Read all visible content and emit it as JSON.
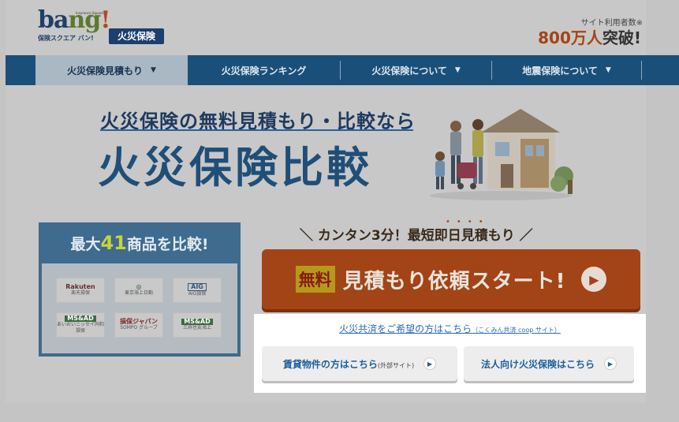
{
  "header": {
    "logo_text": "bang!",
    "logo_tagline": "保険スクエア バン!",
    "logo_mini": "Insurance Square",
    "product_badge": "火災保険",
    "users_label": "サイト利用者数※",
    "users_count": "800万人",
    "users_suffix": "突破!"
  },
  "nav": {
    "items": [
      {
        "label": "火災保険見積もり",
        "has_caret": true,
        "active": true
      },
      {
        "label": "火災保険ランキング",
        "has_caret": false,
        "active": false
      },
      {
        "label": "火災保険について",
        "has_caret": true,
        "active": false
      },
      {
        "label": "地震保険について",
        "has_caret": true,
        "active": false
      }
    ],
    "caret": "▼"
  },
  "hero": {
    "subtitle": "火災保険の無料見積もり・比較なら",
    "title": "火災保険比較"
  },
  "compare": {
    "title_prefix": "最大",
    "title_number": "41",
    "title_suffix": "商品を比較!",
    "insurers": [
      {
        "main": "Rakuten",
        "sub": "楽天損保",
        "kind": "rakuten"
      },
      {
        "main": "◎",
        "sub": "東京海上日動",
        "kind": "tokio"
      },
      {
        "main": "AIG",
        "sub": "AIG損保",
        "kind": "aig"
      },
      {
        "main": "MS&AD",
        "sub": "あいおいニッセイ同和損保",
        "kind": "ms"
      },
      {
        "main": "損保ジャパン",
        "sub": "SOMPO グループ",
        "kind": "sompo"
      },
      {
        "main": "MS&AD",
        "sub": "三井住友海上",
        "kind": "ms"
      }
    ]
  },
  "cta": {
    "lead": "＼ カンタン3分！最短即日見積もり ／",
    "free_badge": "無料",
    "button_text": "見積もり依頼スタート!",
    "arrow": "▶"
  },
  "links": {
    "kyosai": "火災共済をご希望の方はこちら",
    "kyosai_note": "（こくみん共済 coop サイト）",
    "rental_label": "賃貸物件の方はこちら",
    "rental_note": "(外部サイト)",
    "corporate_label": "法人向け火災保険はこちら",
    "arrow": "▶"
  },
  "colors": {
    "nav_bg": "#1a4f7a",
    "cta_bg": "#a34416",
    "brand_navy": "#1f4f78"
  }
}
